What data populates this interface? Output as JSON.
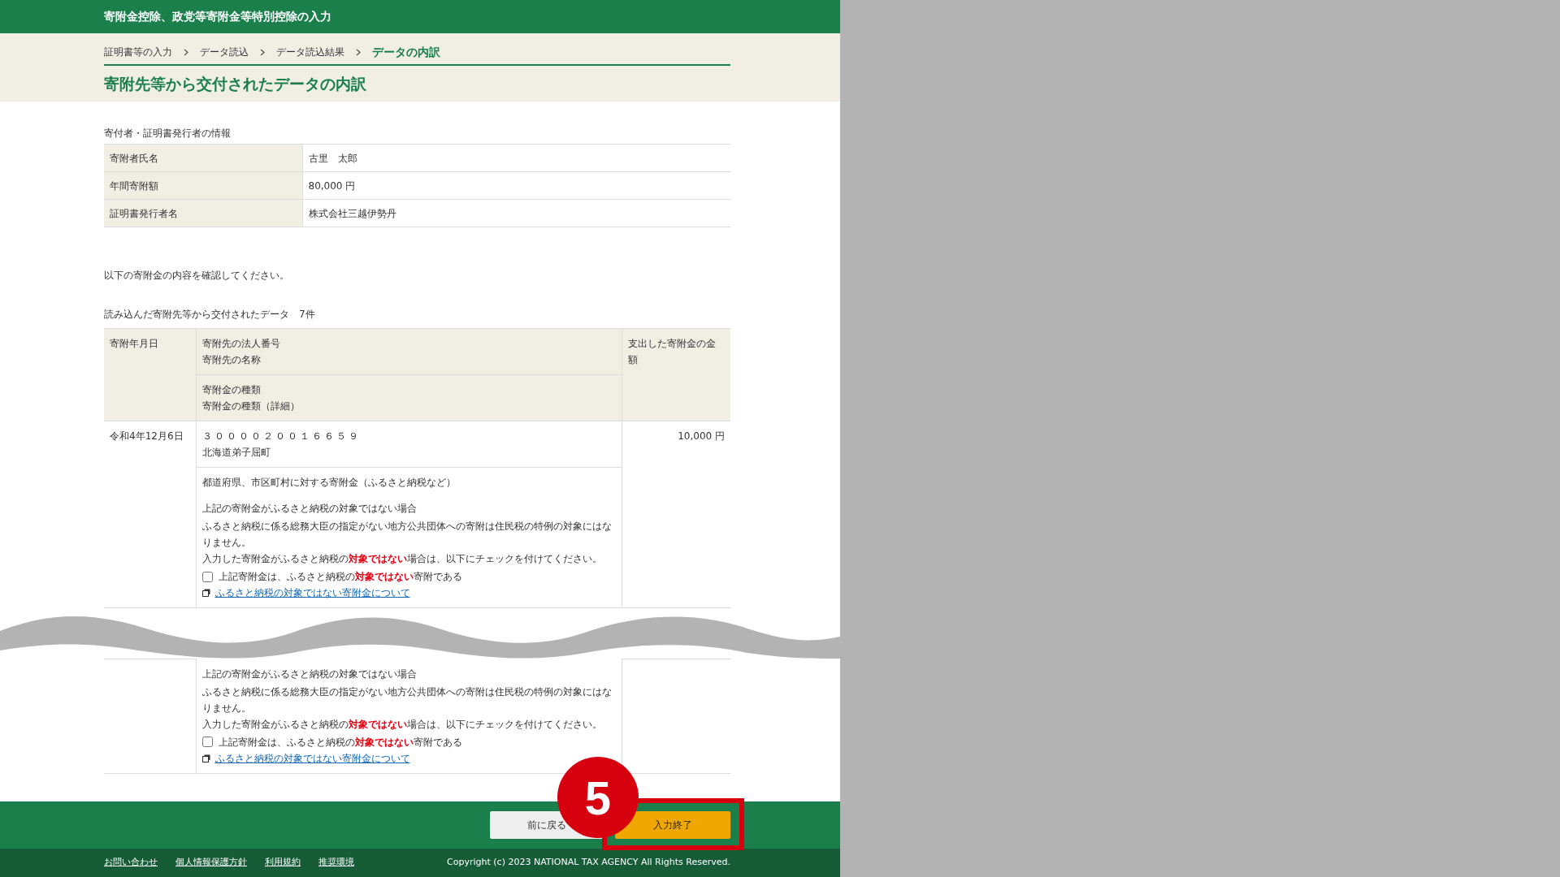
{
  "header": {
    "title": "寄附金控除、政党等寄附金等特別控除の入力"
  },
  "breadcrumb": [
    {
      "label": "証明書等の入力",
      "selected": false
    },
    {
      "label": "データ読込",
      "selected": false
    },
    {
      "label": "データ読込結果",
      "selected": false
    },
    {
      "label": "データの内訳",
      "selected": true
    }
  ],
  "page_title": "寄附先等から交付されたデータの内訳",
  "donor_info": {
    "caption": "寄付者・証明書発行者の情報",
    "rows": [
      {
        "label": "寄附者氏名",
        "value": "古里　太郎"
      },
      {
        "label": "年間寄附額",
        "value": "80,000 円"
      },
      {
        "label": "証明書発行者名",
        "value": "株式会社三越伊勢丹"
      }
    ]
  },
  "instruction": "以下の寄附金の内容を確認してください。",
  "data_caption": "読み込んだ寄附先等から交付されたデータ　7件",
  "donations_table": {
    "columns": {
      "date": "寄附年月日",
      "recipient": [
        "寄附先の法人番号",
        "寄附先の名称"
      ],
      "type": [
        "寄附金の種類",
        "寄附金の種類（詳細）"
      ],
      "amount": "支出した寄附金の金額"
    },
    "rows": [
      {
        "date": "令和4年12月6日",
        "corp_number": "３００００２００１６６５９",
        "recipient": "北海道弟子屈町",
        "amount": "10,000 円",
        "type": "都道府県、市区町村に対する寄附金（ふるさと納税など）",
        "notice_title": "上記の寄附金がふるさと納税の対象ではない場合",
        "notice_text": "ふるさと納税に係る総務大臣の指定がない地方公共団体への寄附は住民税の特例の対象にはなりません。",
        "check_instruction": "入力した寄附金がふるさと納税の**対象ではない**場合は、以下にチェックを付けてください。",
        "checkbox": {
          "label": "上記寄附金は、ふるさと納税の**対象ではない**寄附である",
          "checked": false
        },
        "link": "ふるさと納税の対象ではない寄附金について"
      },
      {
        "notice_title": "上記の寄附金がふるさと納税の対象ではない場合",
        "notice_text": "ふるさと納税に係る総務大臣の指定がない地方公共団体への寄附は住民税の特例の対象にはなりません。",
        "check_instruction": "入力した寄附金がふるさと納税の**対象ではない**場合は、以下にチェックを付けてください。",
        "checkbox": {
          "label": "上記寄附金は、ふるさと納税の**対象ではない**寄附である",
          "checked": false
        },
        "link": "ふるさと納税の対象ではない寄附金について"
      }
    ]
  },
  "buttons": {
    "back": "前に戻る",
    "finish": "入力終了"
  },
  "annotation": {
    "step": "5"
  },
  "footer": {
    "links": [
      "お問い合わせ",
      "個人情報保護方針",
      "利用規約",
      "推奨環境"
    ],
    "copyright": "Copyright (c) 2023 NATIONAL TAX AGENCY All Rights Reserved."
  }
}
